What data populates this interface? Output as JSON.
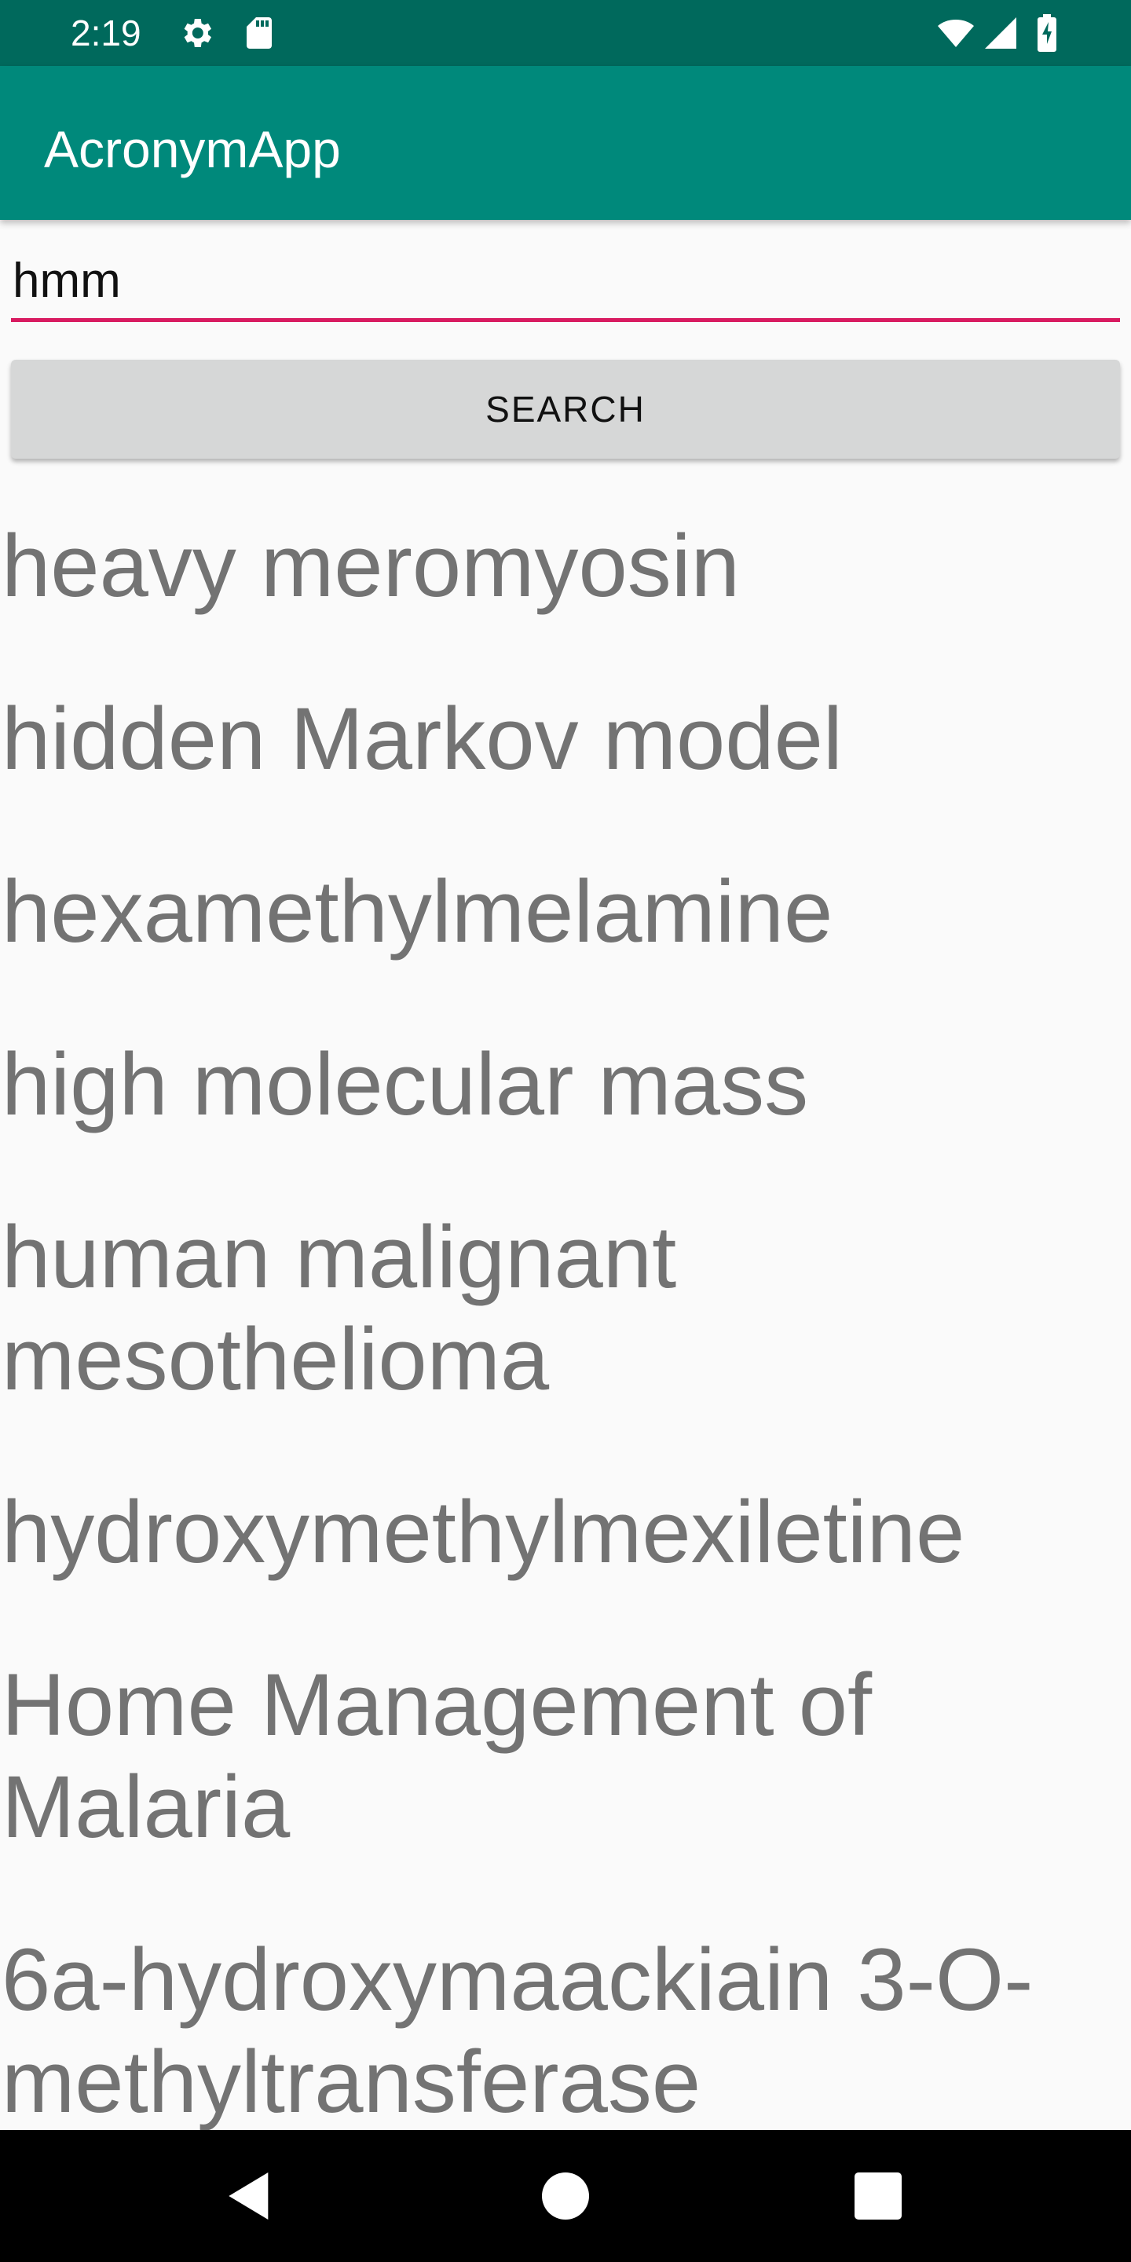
{
  "status_bar": {
    "time": "2:19",
    "icons": [
      "gear-icon",
      "sd-card-icon",
      "wifi-icon",
      "cell-signal-icon",
      "battery-charging-icon"
    ],
    "background": "#00695c"
  },
  "app_bar": {
    "title": "AcronymApp",
    "background": "#00897b"
  },
  "search": {
    "value": "hmm",
    "underline_color": "#d81b60",
    "button_label": "SEARCH"
  },
  "results": [
    "heavy meromyosin",
    "hidden Markov model",
    "hexamethylmelamine",
    "high molecular mass",
    "human malignant mesothelioma",
    "hydroxymethylmexiletine",
    "Home Management of Malaria",
    "6a-hydroxymaackiain 3-O-methyltransferase"
  ],
  "nav_bar": {
    "buttons": [
      "back-icon",
      "home-icon",
      "recents-icon"
    ]
  }
}
